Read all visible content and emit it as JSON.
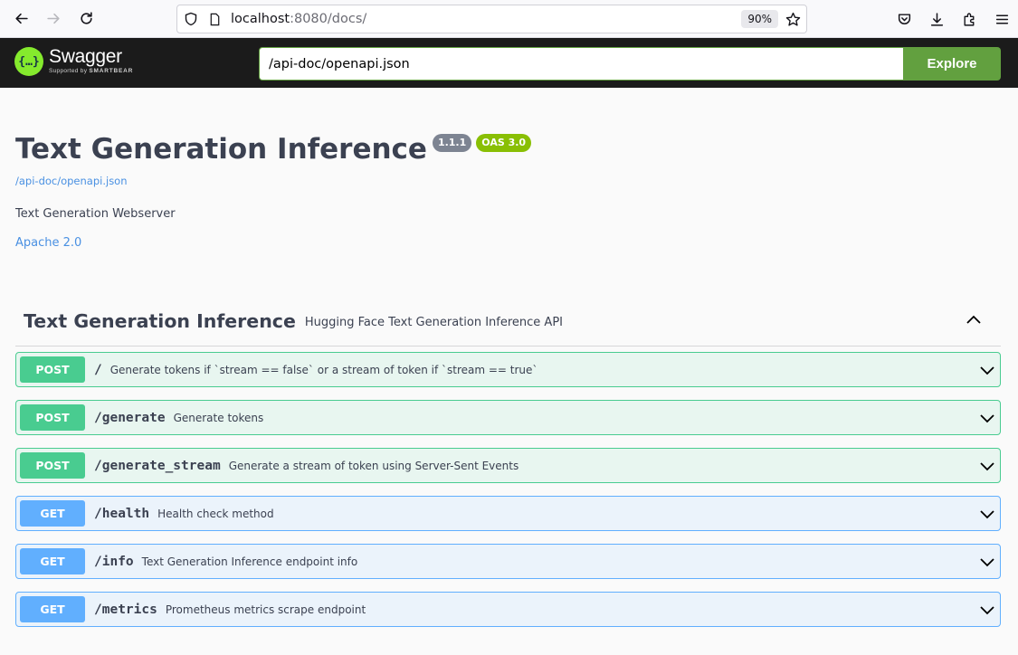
{
  "browser": {
    "url_host": "localhost",
    "url_rest": ":8080/docs/",
    "zoom": "90%"
  },
  "topbar": {
    "logo_name": "Swagger",
    "logo_sub_prefix": "Supported by",
    "logo_sub_brand": "SMARTBEAR",
    "spec_url": "/api-doc/openapi.json",
    "explore_label": "Explore"
  },
  "info": {
    "title": "Text Generation Inference",
    "version": "1.1.1",
    "oas": "OAS 3.0",
    "spec_link": "/api-doc/openapi.json",
    "description": "Text Generation Webserver",
    "license": "Apache 2.0"
  },
  "tag": {
    "name": "Text Generation Inference",
    "description": "Hugging Face Text Generation Inference API"
  },
  "operations": [
    {
      "method": "POST",
      "path": "/",
      "summary": "Generate tokens if `stream == false` or a stream of token if `stream == true`"
    },
    {
      "method": "POST",
      "path": "/generate",
      "summary": "Generate tokens"
    },
    {
      "method": "POST",
      "path": "/generate_stream",
      "summary": "Generate a stream of token using Server-Sent Events"
    },
    {
      "method": "GET",
      "path": "/health",
      "summary": "Health check method"
    },
    {
      "method": "GET",
      "path": "/info",
      "summary": "Text Generation Inference endpoint info"
    },
    {
      "method": "GET",
      "path": "/metrics",
      "summary": "Prometheus metrics scrape endpoint"
    }
  ],
  "colors": {
    "post": "#49cc90",
    "get": "#61affe",
    "explore": "#62a03f",
    "oas_badge": "#89bf04",
    "version_badge": "#7d8492"
  }
}
